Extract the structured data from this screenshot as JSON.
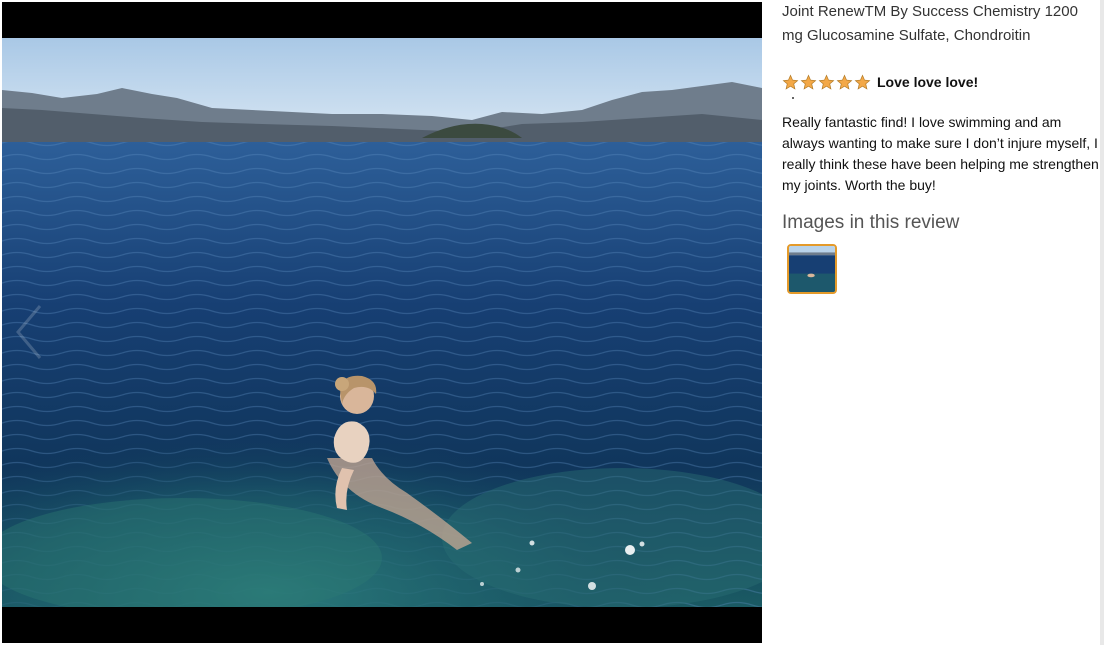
{
  "review": {
    "product_title": "Joint RenewTM By Success Chemistry 1200 mg Glucosamine Sulfate, Chondroitin",
    "rating": 5,
    "rating_max": 5,
    "headline": "Love love love!",
    "body": "Really fantastic find! I love swimming and am always wanting to make sure I don’t injure myself, I really think these have been helping me strengthen my joints. Worth the buy!",
    "images_heading": "Images in this review"
  },
  "colors": {
    "star": "#f3a847",
    "thumb_border": "#e49a2a",
    "sky": "#b9d3ea",
    "lake_deep": "#0d3a66",
    "lake_shallow": "#1f6a7a"
  },
  "icons": {
    "star": "star-icon",
    "prev": "chevron-left-icon"
  }
}
